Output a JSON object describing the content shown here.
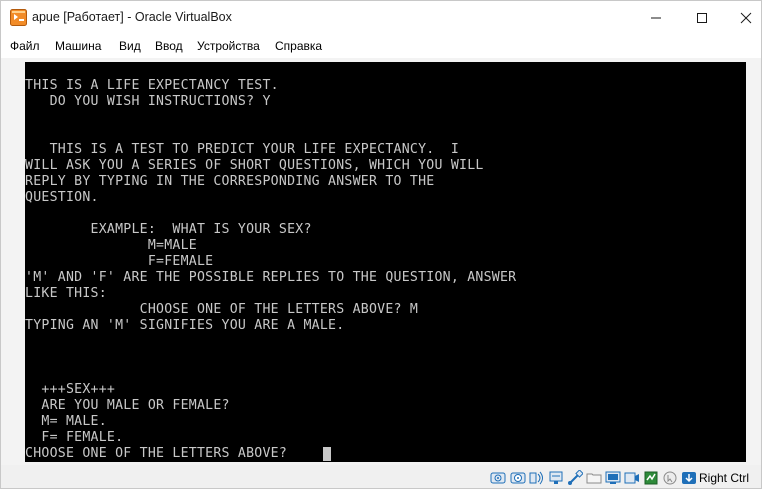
{
  "window": {
    "title": "apue [Работает] - Oracle VirtualBox"
  },
  "menu": {
    "items": [
      "Файл",
      "Машина",
      "Вид",
      "Ввод",
      "Устройства",
      "Справка"
    ]
  },
  "terminal": {
    "lines": [
      "THIS IS A LIFE EXPECTANCY TEST.",
      "   DO YOU WISH INSTRUCTIONS? Y",
      "",
      "",
      "   THIS IS A TEST TO PREDICT YOUR LIFE EXPECTANCY.  I",
      "WILL ASK YOU A SERIES OF SHORT QUESTIONS, WHICH YOU WILL",
      "REPLY BY TYPING IN THE CORRESPONDING ANSWER TO THE",
      "QUESTION.",
      "",
      "        EXAMPLE:  WHAT IS YOUR SEX?",
      "               M=MALE",
      "               F=FEMALE",
      "'M' AND 'F' ARE THE POSSIBLE REPLIES TO THE QUESTION, ANSWER",
      "LIKE THIS:",
      "              CHOOSE ONE OF THE LETTERS ABOVE? M",
      "TYPING AN 'M' SIGNIFIES YOU ARE A MALE.",
      "",
      "",
      "",
      "  +++SEX+++",
      "  ARE YOU MALE OR FEMALE?",
      "  M= MALE.",
      "  F= FEMALE.",
      "CHOOSE ONE OF THE LETTERS ABOVE? "
    ]
  },
  "statusbar": {
    "host_key": "Right Ctrl",
    "icons": [
      "hard-disk-icon",
      "optical-drive-icon",
      "audio-icon",
      "network-icon",
      "usb-icon",
      "shared-folders-icon",
      "display-icon",
      "recording-icon",
      "cpu-activity-icon",
      "mouse-integration-icon",
      "keyboard-capture-icon"
    ]
  },
  "colors": {
    "terminal_bg": "#000000",
    "terminal_fg": "#c8c8c8",
    "chrome_bg": "#f3f3f3",
    "accent_blue": "#1f6fb8",
    "accent_green": "#2e8b3a"
  }
}
